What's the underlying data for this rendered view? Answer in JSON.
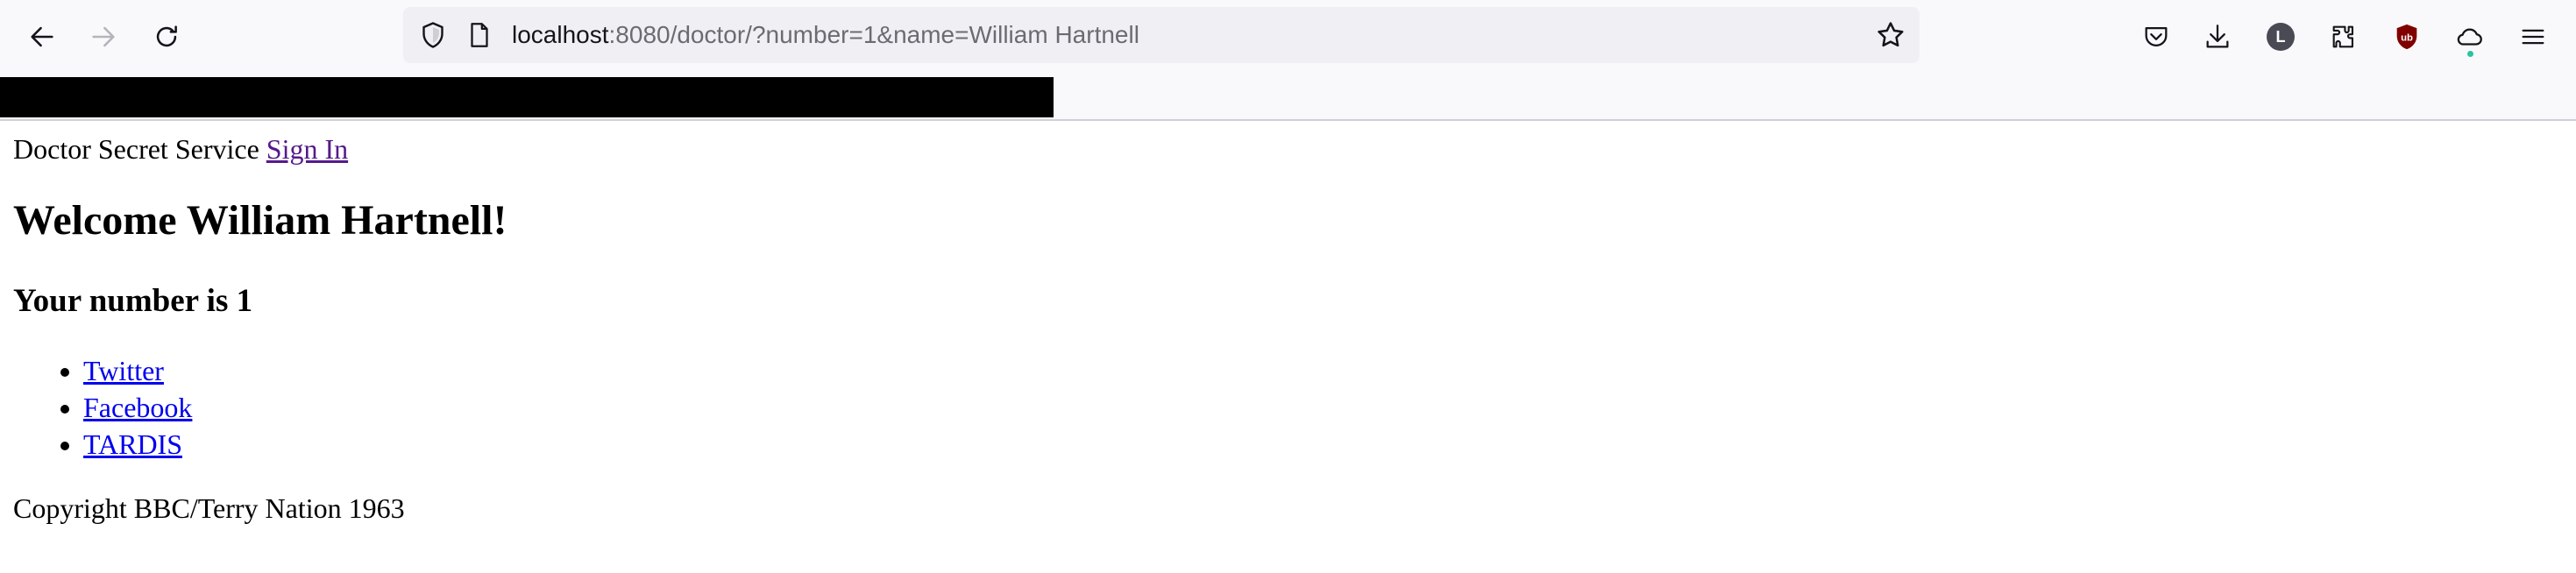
{
  "browser": {
    "url_host": "localhost",
    "url_rest": ":8080/doctor/?number=1&name=William Hartnell",
    "account_initial": "L",
    "colors": {
      "chrome_bg": "#f9f9fb",
      "urlbar_bg": "#f0f0f4",
      "ublock_red": "#800000",
      "sync_dot": "#2ac3a2"
    },
    "icons": [
      "back-arrow-icon",
      "forward-arrow-icon",
      "reload-icon",
      "shield-icon",
      "page-icon",
      "star-icon",
      "pocket-icon",
      "download-icon",
      "account-icon",
      "extensions-icon",
      "ublock-icon",
      "sync-icon",
      "hamburger-menu-icon"
    ]
  },
  "page": {
    "site_name": "Doctor Secret Service",
    "sign_in_label": "Sign In",
    "welcome_heading": "Welcome William Hartnell!",
    "number_heading": "Your number is 1",
    "links": [
      {
        "label": "Twitter"
      },
      {
        "label": "Facebook"
      },
      {
        "label": "TARDIS"
      }
    ],
    "copyright": "Copyright BBC/Terry Nation 1963",
    "colors": {
      "visited_link": "#551a8b",
      "link": "#0000ee"
    }
  }
}
